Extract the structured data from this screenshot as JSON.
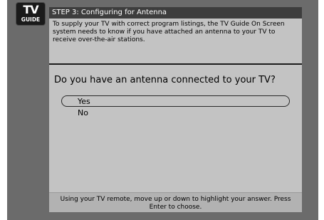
{
  "logo": {
    "line1": "TV",
    "line2": "GUIDE"
  },
  "header": {
    "title": "STEP 3: Configuring for Antenna"
  },
  "intro_text": "To supply your TV with correct program listings, the TV Guide On Screen system needs to know if you have attached an antenna to your TV to receive over-the-air stations.",
  "question": "Do you have an antenna connected to your TV?",
  "options": [
    {
      "label": "Yes",
      "selected": true
    },
    {
      "label": "No",
      "selected": false
    }
  ],
  "footer": {
    "hint": "Using your TV remote, move up or down to highlight your answer.  Press Enter to choose."
  }
}
